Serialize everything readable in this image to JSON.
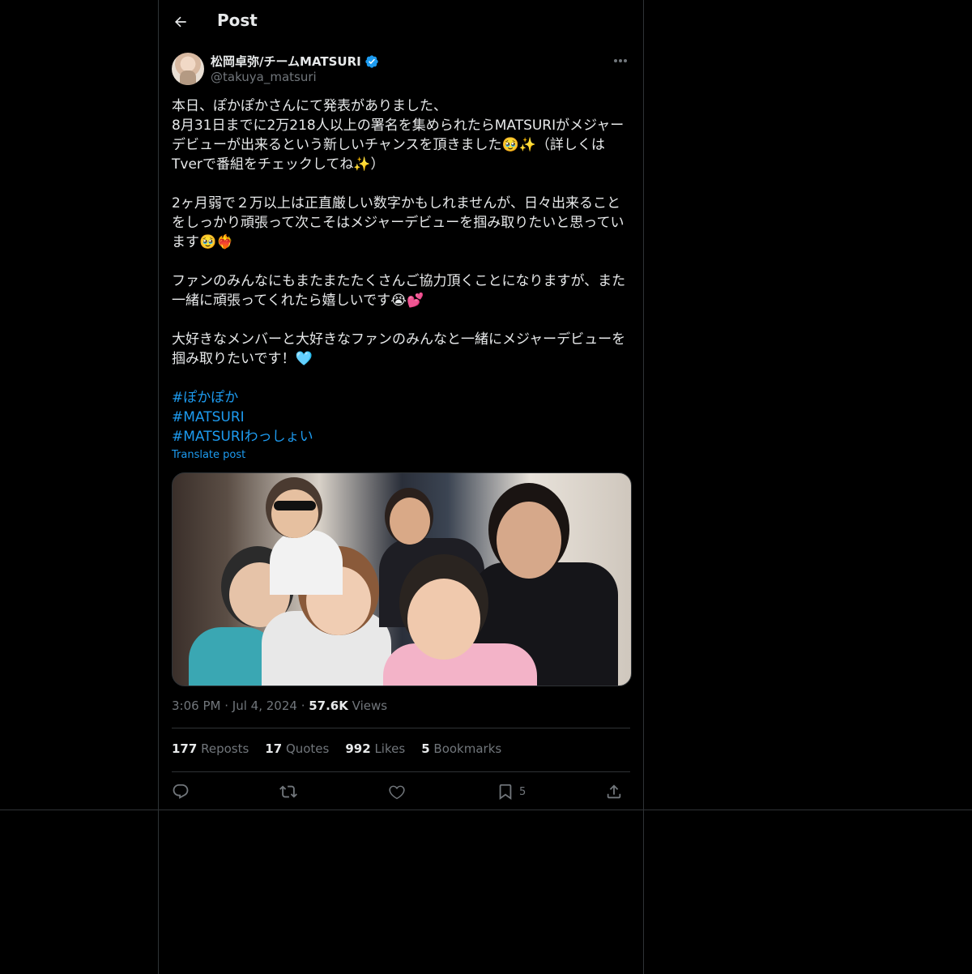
{
  "header": {
    "title": "Post",
    "back_icon": "arrow-left-icon"
  },
  "author": {
    "display_name": "松岡卓弥/チームMATSURI",
    "handle": "@takuya_matsuri",
    "verified": true,
    "verified_color": "#1d9bf0"
  },
  "post": {
    "text": "本日、ぽかぽかさんにて発表がありました、\n8月31日までに2万218人以上の署名を集められたらMATSURIがメジャーデビューが出来るという新しいチャンスを頂きました🥹✨（詳しくはTverで番組をチェックしてね✨）\n\n2ヶ月弱で２万以上は正直厳しい数字かもしれませんが、日々出来ることをしっかり頑張って次こそはメジャーデビューを掴み取りたいと思っています🥹❤️‍🔥\n\nファンのみんなにもまたまたたくさんご協力頂くことになりますが、また一緒に頑張ってくれたら嬉しいです😭💕\n\n大好きなメンバーと大好きなファンのみんなと一緒にメジャーデビューを掴み取りたいです！🩵",
    "hashtags": [
      "#ぽかぽか",
      "#MATSURI",
      "#MATSURIわっしょい"
    ],
    "translate": "Translate post",
    "media_alt": "group selfie photo"
  },
  "meta": {
    "time": "3:06 PM",
    "date": "Jul 4, 2024",
    "views_count": "57.6K",
    "views_label": "Views"
  },
  "stats": {
    "reposts_count": "177",
    "reposts_label": "Reposts",
    "quotes_count": "17",
    "quotes_label": "Quotes",
    "likes_count": "992",
    "likes_label": "Likes",
    "bookmarks_count": "5",
    "bookmarks_label": "Bookmarks"
  },
  "actions": {
    "bookmark_count": "5"
  },
  "colors": {
    "accent": "#1d9bf0",
    "muted": "#71767b",
    "background": "#000000"
  }
}
